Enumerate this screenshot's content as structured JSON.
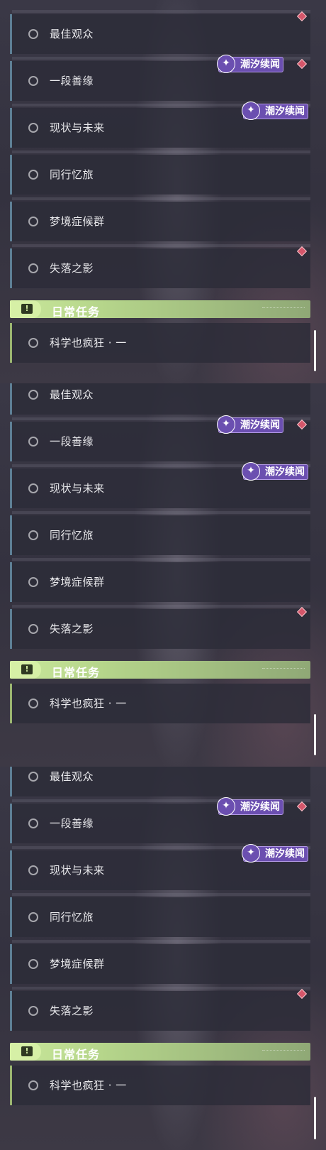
{
  "panels": [
    {
      "quests": [
        {
          "label": "最佳观众"
        },
        {
          "label": "一段善缘"
        },
        {
          "label": "现状与未来"
        },
        {
          "label": "同行忆旅"
        },
        {
          "label": "梦境症候群"
        },
        {
          "label": "失落之影"
        }
      ],
      "event_tag": "潮汐续闻",
      "daily": {
        "title": "日常任务",
        "quest": "科学也疯狂 · 一"
      }
    },
    {
      "quests": [
        {
          "label": "最佳观众"
        },
        {
          "label": "一段善缘"
        },
        {
          "label": "现状与未来"
        },
        {
          "label": "同行忆旅"
        },
        {
          "label": "梦境症候群"
        },
        {
          "label": "失落之影"
        }
      ],
      "event_tag": "潮汐续闻",
      "daily": {
        "title": "日常任务",
        "quest": "科学也疯狂 · 一"
      }
    },
    {
      "quests": [
        {
          "label": "最佳观众"
        },
        {
          "label": "一段善缘"
        },
        {
          "label": "现状与未来"
        },
        {
          "label": "同行忆旅"
        },
        {
          "label": "梦境症候群"
        },
        {
          "label": "失落之影"
        }
      ],
      "event_tag": "潮汐续闻",
      "daily": {
        "title": "日常任务",
        "quest": "科学也疯狂 · 一"
      }
    }
  ],
  "icons": {
    "status": "circle-icon",
    "tag": "tide-event-icon",
    "marker": "red-diamond-icon",
    "daily": "exclamation-icon"
  },
  "colors": {
    "tag_bg": "#6b4fb0",
    "daily_header": "#c9e79b",
    "marker": "#d5566a",
    "row_accent": "#5e7f95"
  }
}
